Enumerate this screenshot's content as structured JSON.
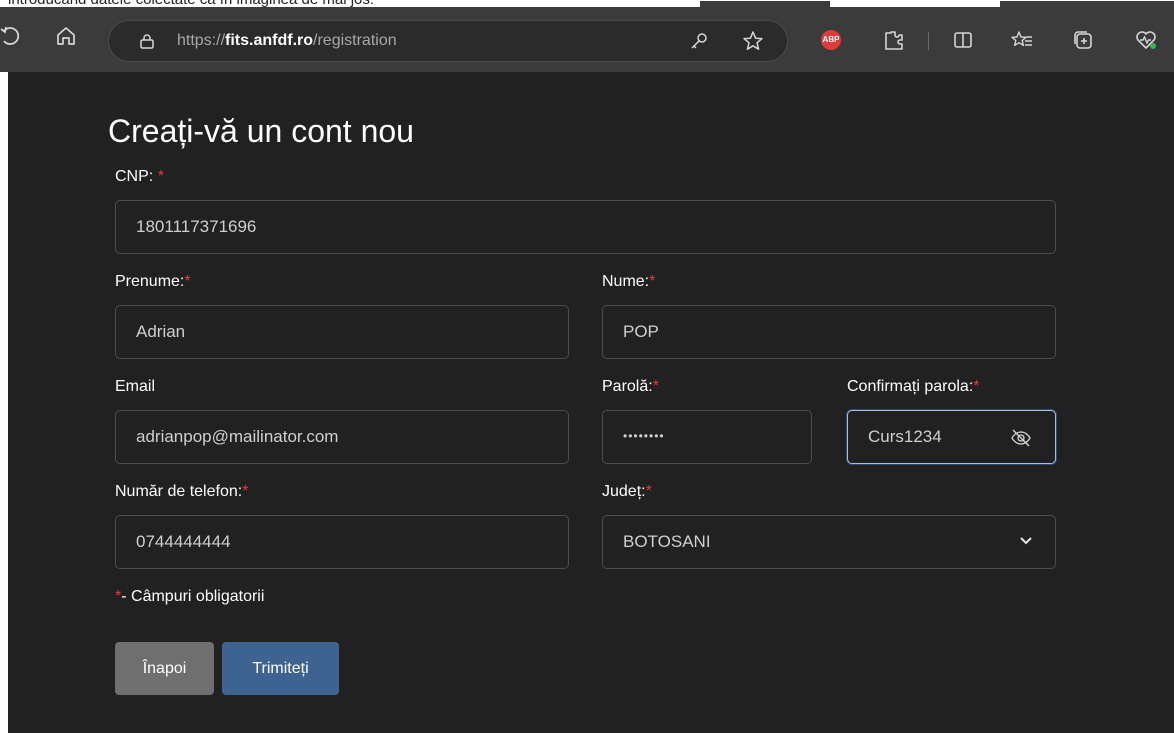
{
  "caption": "introducând datele colectate ca în imaginea de mai jos:",
  "browser": {
    "url_prefix": "https://",
    "url_domain": "fits.anfdf.ro",
    "url_path": "/registration",
    "abp_label": "ABP"
  },
  "form": {
    "title": "Creați-vă un cont nou",
    "required_mark": "*",
    "cnp": {
      "label": "CNP:",
      "value": "1801117371696"
    },
    "prenume": {
      "label": "Prenume:",
      "value": "Adrian"
    },
    "nume": {
      "label": "Nume:",
      "value": "POP"
    },
    "email": {
      "label": "Email",
      "value": "adrianpop@mailinator.com"
    },
    "parola": {
      "label": "Parolă:",
      "value": "••••••••"
    },
    "confirm": {
      "label": "Confirmați parola:",
      "value": "Curs1234"
    },
    "telefon": {
      "label": "Număr de telefon:",
      "value": "0744444444"
    },
    "judet": {
      "label": "Județ:",
      "value": "BOTOSANI"
    },
    "note": "- Câmpuri obligatorii",
    "back_label": "Înapoi",
    "submit_label": "Trimiteți"
  }
}
